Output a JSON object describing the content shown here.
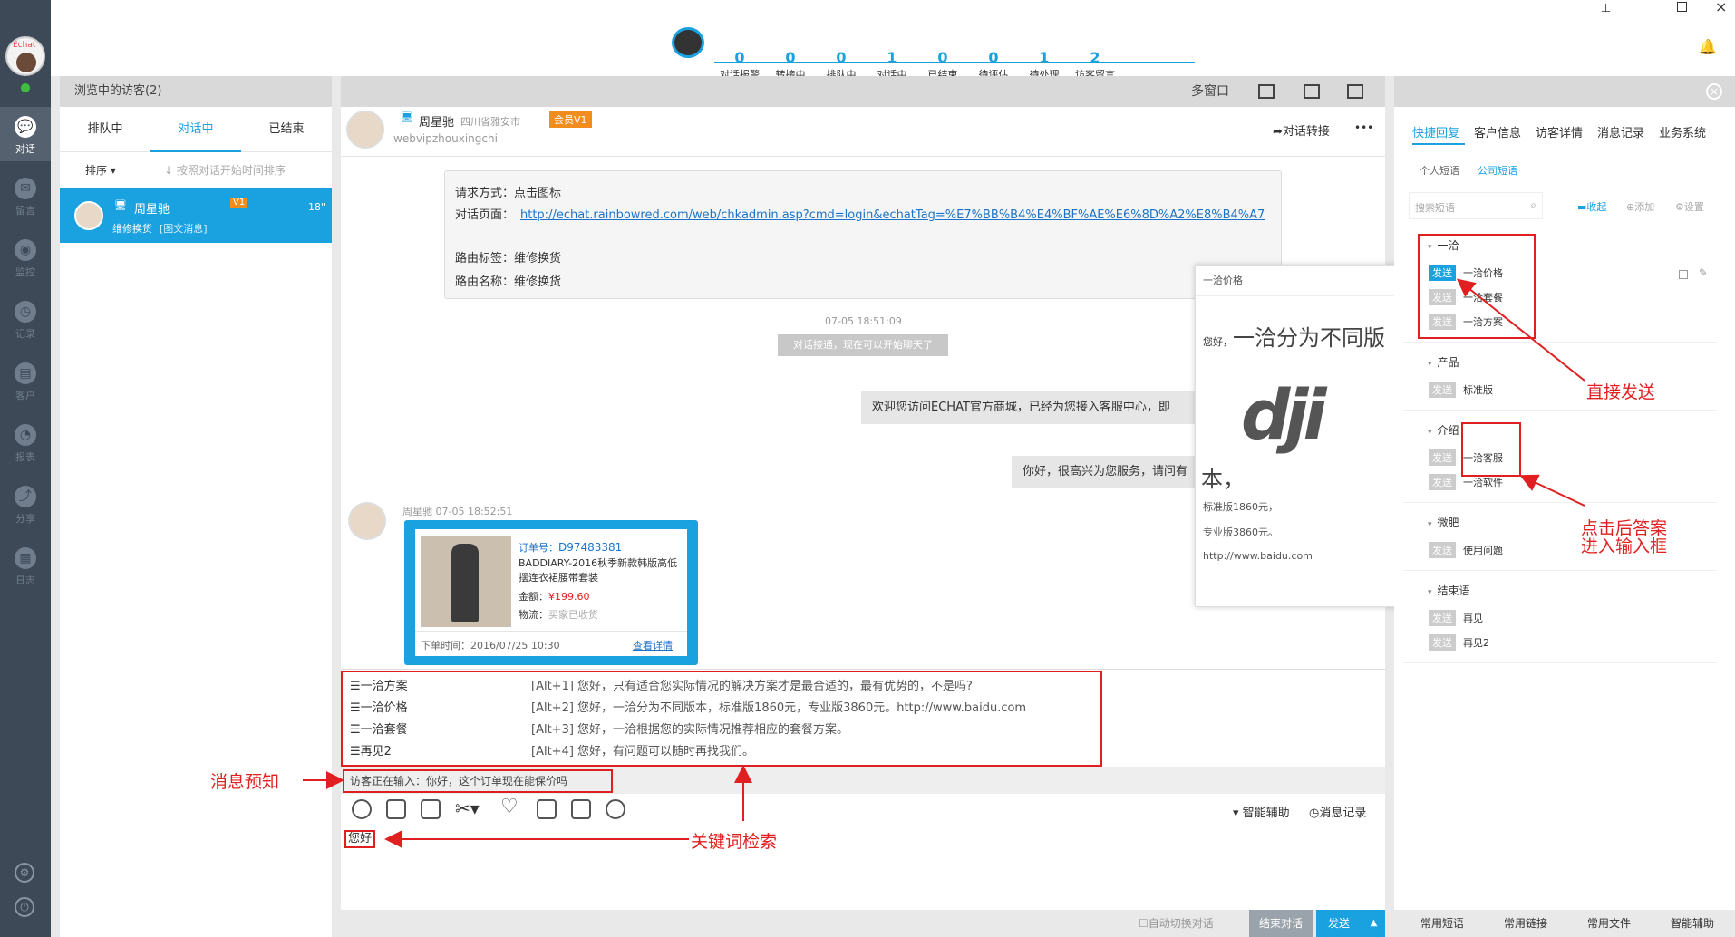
{
  "stats": [
    {
      "v": "0",
      "l": "对话报警"
    },
    {
      "v": "0",
      "l": "转接中"
    },
    {
      "v": "0",
      "l": "排队中"
    },
    {
      "v": "1",
      "l": "对话中"
    },
    {
      "v": "0",
      "l": "已结束"
    },
    {
      "v": "0",
      "l": "待评估"
    },
    {
      "v": "1",
      "l": "待处理"
    },
    {
      "v": "2",
      "l": "访客留言"
    }
  ],
  "nav": [
    {
      "l": "对话",
      "i": "💬"
    },
    {
      "l": "留言",
      "i": "✉"
    },
    {
      "l": "监控",
      "i": "◉"
    },
    {
      "l": "记录",
      "i": "◷"
    },
    {
      "l": "客户",
      "i": "▤"
    },
    {
      "l": "报表",
      "i": "◔"
    },
    {
      "l": "分享",
      "i": "⤴"
    },
    {
      "l": "日志",
      "i": "▦"
    }
  ],
  "avatar_text": "Echat",
  "left": {
    "title": "浏览中的访客(2)",
    "tabs": [
      "排队中",
      "对话中",
      "已结束"
    ],
    "sort": "排序 ▾",
    "sort_hint": "↓ 按照对话开始时间排序",
    "visitor": {
      "name": "周星驰",
      "sub": "维修换货",
      "tag": "[图文消息]",
      "badge": "V1",
      "time": "18\""
    }
  },
  "center": {
    "win_label": "多窗口",
    "visitor_name": "周星驰",
    "visitor_loc": "四川省雅安市",
    "visitor_id": "webvipzhouxingchi",
    "member": "会员V1",
    "transfer": "对话转接",
    "more": "•••",
    "info": [
      {
        "k": "请求方式：",
        "v": "点击图标"
      },
      {
        "k": "对话页面：",
        "v": "http://echat.rainbowred.com/web/chkadmin.asp?cmd=login&echatTag=%E7%BB%B4%E4%BF%AE%E6%8D%A2%E8%B4%A7"
      },
      {
        "k": "路由标签：",
        "v": "维修换货"
      },
      {
        "k": "路由名称：",
        "v": "维修换货"
      }
    ],
    "time1": "07-05 18:51:09",
    "sys": "对话接通，现在可以开始聊天了",
    "msg1": "欢迎您访问ECHAT官方商城，已经为您接入客服中心，即",
    "msg2": "你好，很高兴为您服务，请问有",
    "visitor_meta": "周星驰 07-05 18:52:51",
    "order": {
      "no_label": "订单号：",
      "no": "D97483381",
      "title": "BADDIARY-2016秋季新款韩版高低摆连衣裙腰带套装",
      "amt_label": "金额：",
      "amt": "¥199.60",
      "ship_label": "物流：",
      "ship": "买家已收货",
      "date": "下单时间：2016/07/25 10:30",
      "detail": "查看详情"
    },
    "quick": [
      {
        "n": "☰一洽方案",
        "k": "[Alt+1]  您好，只有适合您实际情况的解决方案才是最合适的，最有优势的，不是吗?"
      },
      {
        "n": "☰一洽价格",
        "k": "[Alt+2]  您好，一洽分为不同版本，标准版1860元，专业版3860元。http://www.baidu.com"
      },
      {
        "n": "☰一洽套餐",
        "k": "[Alt+3]  您好，一洽根据您的实际情况推荐相应的套餐方案。"
      },
      {
        "n": "☰再见2",
        "k": "[Alt+4]  您好，有问题可以随时再找我们。"
      }
    ],
    "typing": "访客正在输入：你好，这个订单现在能保价吗",
    "assist": "▾ 智能辅助",
    "history": "◷消息记录",
    "input_value": "您好",
    "autoswitch": "自动切换对话",
    "end": "结束对话",
    "send": "发送"
  },
  "popup": {
    "title": "一洽价格",
    "hello": "您好，",
    "big": "一洽分为不同版",
    "logo": "dji",
    "ben": "本，",
    "l1": "标准版1860元，",
    "l2": "专业版3860元。",
    "l3": "http://www.baidu.com"
  },
  "right": {
    "tabs": [
      "快捷回复",
      "客户信息",
      "访客详情",
      "消息记录",
      "业务系统"
    ],
    "sub": [
      "个人短语",
      "公司短语"
    ],
    "search_ph": "搜索短语",
    "collapse": "收起",
    "add": "添加",
    "setting": "设置",
    "groups": [
      {
        "g": "一洽",
        "items": [
          "一洽价格",
          "一洽套餐",
          "一洽方案"
        ]
      },
      {
        "g": "产品",
        "items": [
          "标准版"
        ]
      },
      {
        "g": "介绍",
        "items": [
          "一洽客服",
          "一洽软件"
        ]
      },
      {
        "g": "微肥",
        "items": [
          "使用问题"
        ]
      },
      {
        "g": "结束语",
        "items": [
          "再见",
          "再见2"
        ]
      }
    ],
    "send": "发送",
    "bottom": [
      "常用短语",
      "常用链接",
      "常用文件",
      "智能辅助"
    ]
  },
  "annotations": {
    "direct": "直接发送",
    "click": "点击后答案",
    "click2": "进入输入框",
    "preview": "消息预知",
    "keyword": "关键词检索"
  }
}
